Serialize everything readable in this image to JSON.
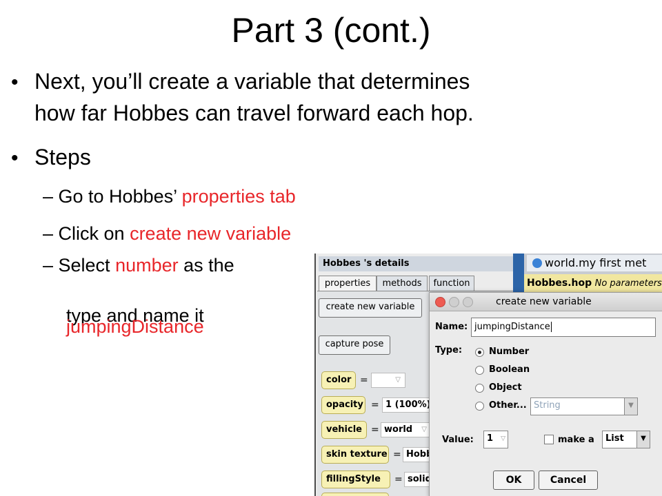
{
  "slide": {
    "title": "Part 3 (cont.)",
    "bullet1_line1": "Next, you’ll create a variable that determines",
    "bullet1_line2": "how far Hobbes can travel forward each hop.",
    "bullet2": "Steps",
    "step1_prefix": "– Go to Hobbes’",
    "step1_highlight": "properties tab",
    "step2_prefix": "– Click on",
    "step2_highlight": "create new variable",
    "step3_prefix": "– Select",
    "step3_highlight": "number",
    "step3_suffix": "as the",
    "step3_line2": "type and name it",
    "step3_line3": "jumpingDistance",
    "highlight_color": "#e8262a"
  },
  "details": {
    "title": "Hobbes 's details",
    "tabs": [
      "properties",
      "methods",
      "function"
    ],
    "create_button": "create new variable",
    "capture_button": "capture pose",
    "properties": [
      {
        "name": "color",
        "value": ""
      },
      {
        "name": "opacity",
        "value": "1 (100%)"
      },
      {
        "name": "vehicle",
        "value": "world"
      },
      {
        "name": "skin texture",
        "value": "Hobb"
      },
      {
        "name": "fillingStyle",
        "value": "solid"
      }
    ],
    "eq": "="
  },
  "editor": {
    "world_tab": "world.my first met",
    "method_name": "Hobbes.hop",
    "method_params": "No parameters"
  },
  "dialog": {
    "title": "create new variable",
    "name_label": "Name:",
    "name_value": "jumpingDistance",
    "type_label": "Type:",
    "types": [
      "Number",
      "Boolean",
      "Object",
      "Other..."
    ],
    "selected_type": "Number",
    "other_value": "String",
    "value_label": "Value:",
    "value": "1",
    "make_a_label": "make a",
    "list_value": "List",
    "ok": "OK",
    "cancel": "Cancel"
  }
}
